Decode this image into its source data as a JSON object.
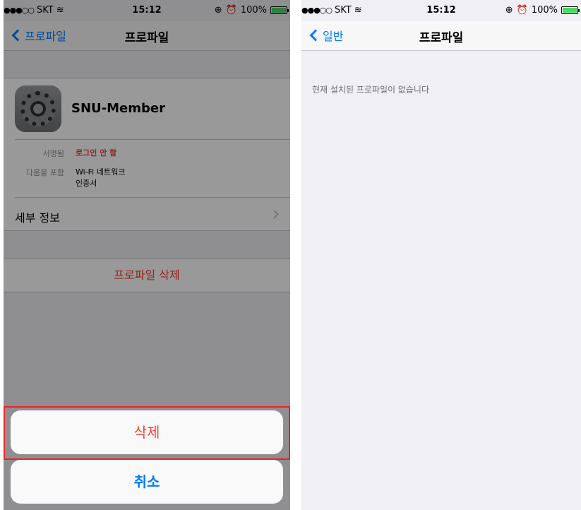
{
  "left": {
    "status": {
      "carrier": "SKT",
      "time": "15:12",
      "battery": "100%"
    },
    "nav": {
      "back_label": "프로파일",
      "title": "프로파일"
    },
    "profile": {
      "name": "SNU-Member",
      "signed_label": "서명됨",
      "signed_value": "로그인 안 함",
      "contains_label": "다음을 포함",
      "contains_values": [
        "Wi-Fi 네트워크",
        "인증서"
      ],
      "details_label": "세부 정보"
    },
    "delete_profile_label": "프로파일 삭제",
    "action_sheet": {
      "delete_label": "삭제",
      "cancel_label": "취소"
    }
  },
  "right": {
    "status": {
      "carrier": "SKT",
      "time": "15:12",
      "battery": "100%"
    },
    "nav": {
      "back_label": "일반",
      "title": "프로파일"
    },
    "empty_message": "현재 설치된 프로파일이 없습니다"
  },
  "colors": {
    "ios_blue": "#007aff",
    "ios_red": "#ff3b30",
    "highlight_red": "#e8262a",
    "battery_green": "#4cd964"
  }
}
